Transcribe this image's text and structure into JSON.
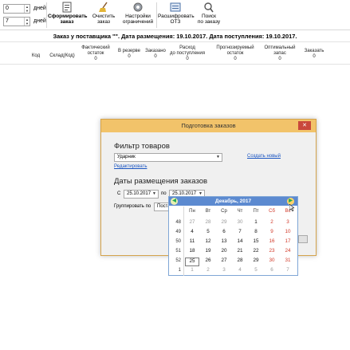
{
  "toolbar": {
    "spin1": {
      "value": "0",
      "unit": "дней"
    },
    "spin2": {
      "value": "7",
      "unit": "дней"
    },
    "buttons": [
      {
        "line1": "Сформировать",
        "line2": "заказ",
        "icon": "form-order-icon"
      },
      {
        "line1": "Очистить",
        "line2": "заказ",
        "icon": "broom-icon"
      },
      {
        "line1": "Настройки",
        "line2": "ограничений",
        "icon": "gear-icon"
      },
      {
        "line1": "Расшифровать",
        "line2": "ОТЗ",
        "icon": "decode-icon"
      },
      {
        "line1": "Поиск",
        "line2": "по заказу",
        "icon": "search-icon"
      }
    ]
  },
  "order_title": "Заказ у поставщика \"\". Дата размещения: 19.10.2017. Дата поступления: 19.10.2017.",
  "columns": [
    {
      "line1": "Код",
      "line2": "",
      "line3": ""
    },
    {
      "line1": "Склад(Код)",
      "line2": "",
      "line3": ""
    },
    {
      "line1": "Фактический",
      "line2": "остаток",
      "line3": "0"
    },
    {
      "line1": "В резерве",
      "line2": "0",
      "line3": ""
    },
    {
      "line1": "Заказано",
      "line2": "0",
      "line3": ""
    },
    {
      "line1": "Расход",
      "line2": "до поступления",
      "line3": "0"
    },
    {
      "line1": "Прогнозируемый",
      "line2": "остаток",
      "line3": "0"
    },
    {
      "line1": "Оптимальный",
      "line2": "запас",
      "line3": "0"
    },
    {
      "line1": "Заказать",
      "line2": "0",
      "line3": ""
    }
  ],
  "dialog": {
    "title": "Подготовка заказов",
    "close": "✕",
    "filter_heading": "Фильтр товаров",
    "filter_value": "Ударник",
    "create_link": "Создать новый",
    "edit_link": "Редактировать",
    "dates_heading": "Даты размещения заказов",
    "from_label": "С",
    "from_value": "25.10.2017",
    "to_label": "по",
    "to_value": "25.10.2017",
    "group_label": "Группировать по",
    "group_value": "Поста"
  },
  "calendar": {
    "month_title": "Декабрь, 2017",
    "dow": [
      "Пн",
      "Вт",
      "Ср",
      "Чт",
      "Пт",
      "Сб",
      "Вс"
    ],
    "weeks": [
      {
        "num": "48",
        "days": [
          "27",
          "28",
          "29",
          "30",
          "1",
          "2",
          "3"
        ]
      },
      {
        "num": "49",
        "days": [
          "4",
          "5",
          "6",
          "7",
          "8",
          "9",
          "10"
        ]
      },
      {
        "num": "50",
        "days": [
          "11",
          "12",
          "13",
          "14",
          "15",
          "16",
          "17"
        ]
      },
      {
        "num": "51",
        "days": [
          "18",
          "19",
          "20",
          "21",
          "22",
          "23",
          "24"
        ]
      },
      {
        "num": "52",
        "days": [
          "25",
          "26",
          "27",
          "28",
          "29",
          "30",
          "31"
        ]
      },
      {
        "num": "1",
        "days": [
          "1",
          "2",
          "3",
          "4",
          "5",
          "6",
          "7"
        ]
      }
    ],
    "highlighted_day": "25"
  }
}
